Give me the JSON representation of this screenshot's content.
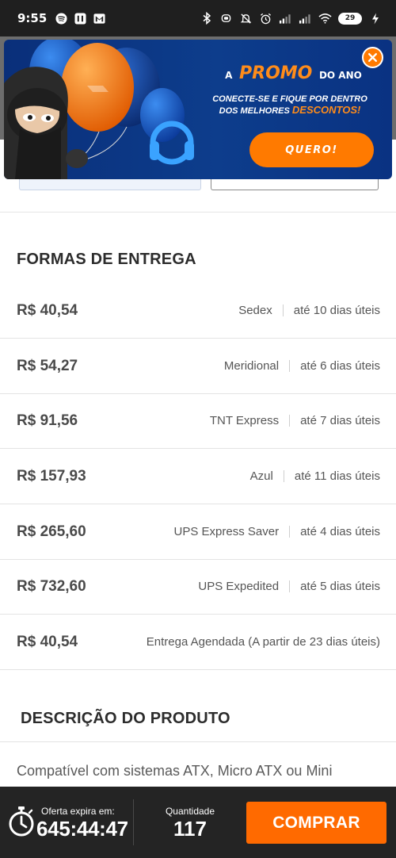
{
  "status_bar": {
    "time": "9:55",
    "battery": "29",
    "left_icons": [
      "spotify-icon",
      "app-icon",
      "gmail-icon"
    ],
    "right_icons": [
      "bluetooth-icon",
      "vibrate-icon",
      "mute-icon",
      "alarm-icon",
      "signal-icon",
      "signal-icon",
      "wifi-icon",
      "battery-icon",
      "charging-icon"
    ]
  },
  "promo": {
    "title_prefix": "A",
    "title_highlight": "PROMO",
    "title_suffix": "DO ANO",
    "subtitle_line1": "CONECTE-SE E FIQUE POR DENTRO",
    "subtitle_line2": "DOS MELHORES",
    "subtitle_highlight": "DESCONTOS!",
    "button_label": "QUERO!",
    "accent_color": "#ff8c1a",
    "background_color": "#0d3d8c"
  },
  "delivery": {
    "title": "FORMAS DE ENTREGA",
    "options": [
      {
        "price": "R$ 40,54",
        "carrier": "Sedex",
        "eta": "até 10 dias úteis"
      },
      {
        "price": "R$ 54,27",
        "carrier": "Meridional",
        "eta": "até 6 dias úteis"
      },
      {
        "price": "R$ 91,56",
        "carrier": "TNT Express",
        "eta": "até 7 dias úteis"
      },
      {
        "price": "R$ 157,93",
        "carrier": "Azul",
        "eta": "até 11 dias úteis"
      },
      {
        "price": "R$ 265,60",
        "carrier": "UPS Express Saver",
        "eta": "até 4 dias úteis"
      },
      {
        "price": "R$ 732,60",
        "carrier": "UPS Expedited",
        "eta": "até 5 dias úteis"
      },
      {
        "price": "R$ 40,54",
        "carrier": "Entrega Agendada (A partir de 23 dias úteis)",
        "eta": ""
      }
    ]
  },
  "description": {
    "title": "DESCRIÇÃO DO PRODUTO",
    "text": "Compatível com sistemas ATX, Micro ATX ou Mini"
  },
  "bottom_bar": {
    "offer_label": "Oferta expira em:",
    "offer_time": "645:44:47",
    "quantity_label": "Quantidade",
    "quantity_value": "117",
    "buy_label": "COMPRAR",
    "buy_color": "#ff6a00"
  }
}
